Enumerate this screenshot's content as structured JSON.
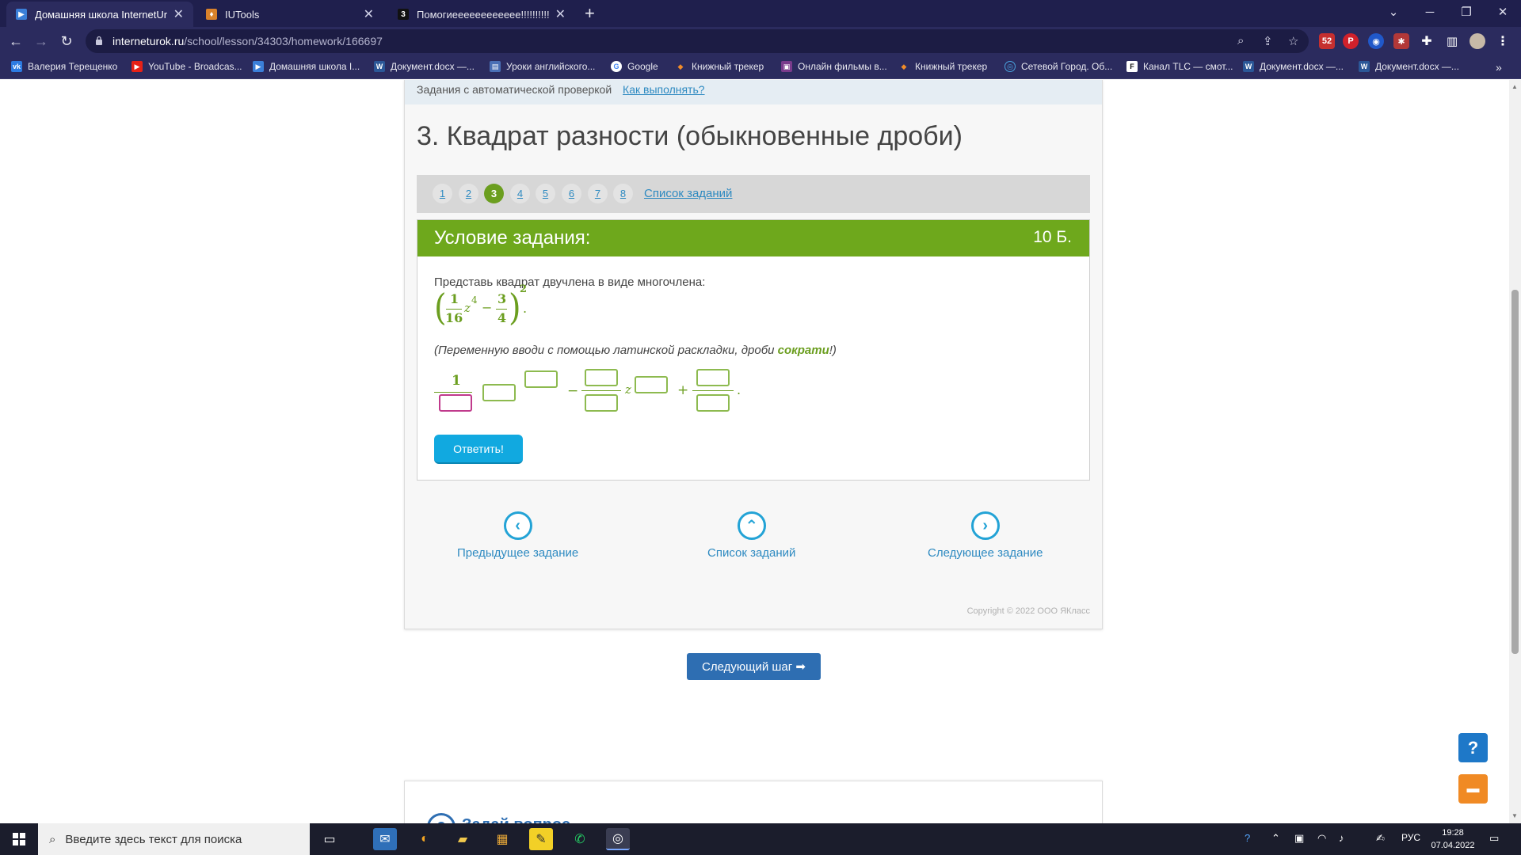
{
  "browser": {
    "tabs": [
      {
        "title": "Домашняя школа InternetUrok.r",
        "active": true,
        "favicon": "internetUrok"
      },
      {
        "title": "IUTools",
        "active": false,
        "favicon": "iutools"
      },
      {
        "title": "Помогиееееееееееее!!!!!!!!!!!",
        "active": false,
        "favicon": "znanija-3"
      }
    ],
    "url_host": "interneturok.ru",
    "url_path": "/school/lesson/34303/homework/166697",
    "extension_badge": "52",
    "bookmarks": [
      "Валерия Терещенко",
      "YouTube - Broadcas...",
      "Домашняя школа I...",
      "Документ.docx —...",
      "Уроки английского...",
      "Google",
      "Книжный трекер",
      "Онлайн фильмы в...",
      "Книжный трекер",
      "Сетевой Город. Об...",
      "Канал TLC — смот...",
      "Документ.docx —...",
      "Документ.docx —..."
    ]
  },
  "page": {
    "auto_check_label": "Задания с автоматической проверкой",
    "how_to_link": "Как выполнять?",
    "task_title": "3. Квадрат разности (обыкновенные дроби)",
    "pager": {
      "numbers": [
        "1",
        "2",
        "3",
        "4",
        "5",
        "6",
        "7",
        "8"
      ],
      "current": "3",
      "list_link": "Список заданий"
    },
    "task": {
      "header": "Условие задания:",
      "points": "10 Б.",
      "question": "Представь квадрат двучлена в виде многочлена:",
      "expression": {
        "num1": "1",
        "den1": "16",
        "var": "z",
        "exp1": "4",
        "minus": "−",
        "num2": "3",
        "den2": "4",
        "outer_exp": "2",
        "end": "."
      },
      "hint_prefix": "(Переменную вводи с помощью латинской раскладки, дроби ",
      "hint_highlight": "сократи",
      "hint_suffix": "!)",
      "answer_template": {
        "num": "1",
        "minus": "−",
        "var": "z",
        "plus": "+",
        "end": "."
      },
      "submit": "Ответить!"
    },
    "nav": {
      "prev": "Предыдущее задание",
      "list": "Список заданий",
      "next": "Следующее задание"
    },
    "copyright": "Copyright © 2022 ООО ЯКласс",
    "next_step": "Следующий шаг ➡",
    "ask_question": "Задай вопрос",
    "help_button": "?"
  },
  "taskbar": {
    "search_placeholder": "Введите здесь текст для поиска",
    "lang": "РУС",
    "time": "19:28",
    "date": "07.04.2022"
  },
  "colors": {
    "task_header_green": "#6ea81c",
    "link_blue": "#2e8ac1",
    "submit_blue": "#11a9e0",
    "next_step_blue": "#2e6eb2",
    "chrome_dark": "#1f1f4d"
  }
}
